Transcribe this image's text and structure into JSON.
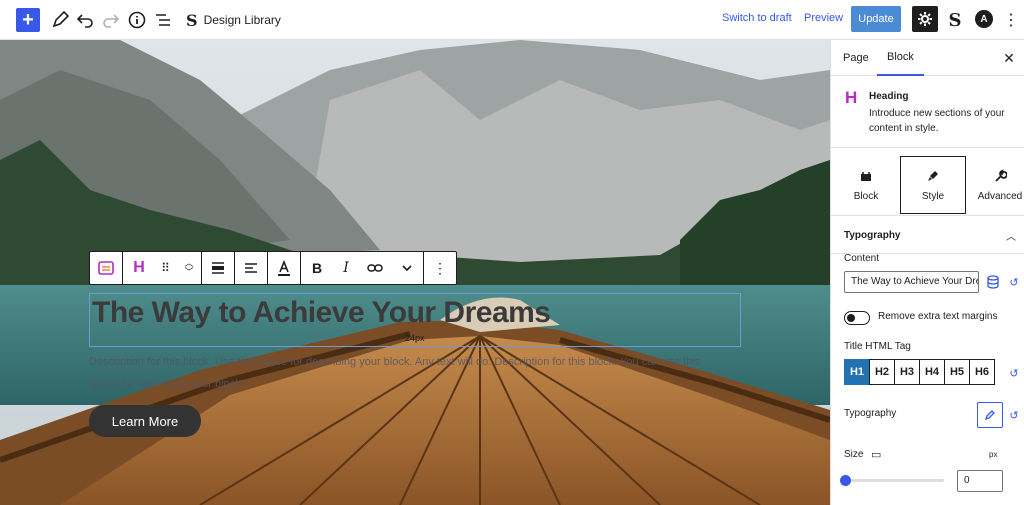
{
  "topbar": {
    "page_title": "Design Library",
    "switch_to_draft": "Switch to draft",
    "preview": "Preview",
    "update": "Update",
    "add_icon": "+",
    "a_logo": "A",
    "brand_logo": "S"
  },
  "canvas": {
    "heading": "The Way to Achieve Your Dreams",
    "size_hint": "24px",
    "description": "Description for this block. Use this space for describing your block. Any text will do. Description for this block. You can use this space for describing your block.",
    "button_label": "Learn More"
  },
  "block_toolbar": {
    "items": [
      "stackable-icon",
      "heading-icon",
      "drag-handle-icon",
      "move-up-down-icon",
      "align-wide-icon",
      "align-left-icon",
      "text-color-icon",
      "bold-icon",
      "italic-icon",
      "link-icon",
      "chevron-down-icon",
      "more-icon"
    ]
  },
  "sidebar": {
    "tabs": [
      "Page",
      "Block"
    ],
    "active_tab": "Block",
    "block_title": "Heading",
    "block_desc": "Introduce new sections of your content in style.",
    "style_tabs": [
      "Block",
      "Style",
      "Advanced"
    ],
    "active_style_tab": "Style",
    "section_title": "Typography",
    "content_label": "Content",
    "content_value": "The Way to Achieve Your Dreams",
    "toggle_label": "Remove extra text margins",
    "html_tag_label": "Title HTML Tag",
    "html_tags": [
      "H1",
      "H2",
      "H3",
      "H4",
      "H5",
      "H6"
    ],
    "active_html_tag": "H1",
    "typography_label": "Typography",
    "size_label": "Size",
    "size_unit": "px",
    "size_value": "0",
    "size_slider_fraction": 0.0
  },
  "colors": {
    "accent": "#3858e9",
    "update_button": "#4b8bd3",
    "active_tag": "#2271b1"
  }
}
